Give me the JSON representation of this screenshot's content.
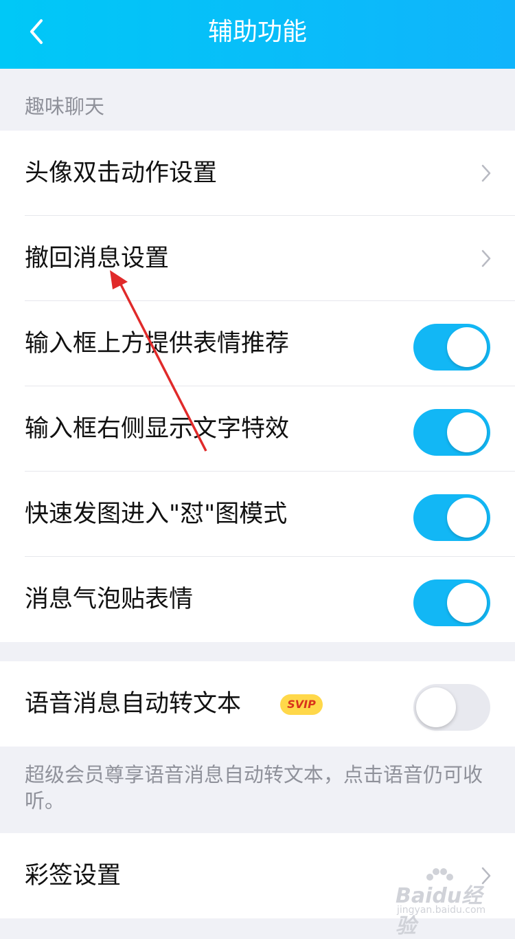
{
  "header": {
    "title": "辅助功能",
    "back_icon": "chevron-left-icon"
  },
  "section1": {
    "label": "趣味聊天",
    "rows": [
      {
        "label": "头像双击动作设置",
        "type": "nav"
      },
      {
        "label": "撤回消息设置",
        "type": "nav"
      },
      {
        "label": "输入框上方提供表情推荐",
        "type": "toggle",
        "checked": true
      },
      {
        "label": "输入框右侧显示文字特效",
        "type": "toggle",
        "checked": true
      },
      {
        "label": "快速发图进入\"怼\"图模式",
        "type": "toggle",
        "checked": true
      },
      {
        "label": "消息气泡贴表情",
        "type": "toggle",
        "checked": true
      }
    ]
  },
  "section2": {
    "row": {
      "label": "语音消息自动转文本",
      "badge": "SVIP",
      "type": "toggle",
      "checked": false
    },
    "note": "超级会员尊享语音消息自动转文本，点击语音仍可收听。"
  },
  "section3": {
    "row": {
      "label": "彩签设置",
      "type": "nav"
    }
  },
  "watermark": {
    "text": "Baidu经验",
    "sub": "jingyan.baidu.com"
  },
  "colors": {
    "accent": "#12b7f5",
    "header_start": "#00c8f7",
    "annotation_arrow": "#e02a2a",
    "badge_bg": "#ffd84a"
  }
}
